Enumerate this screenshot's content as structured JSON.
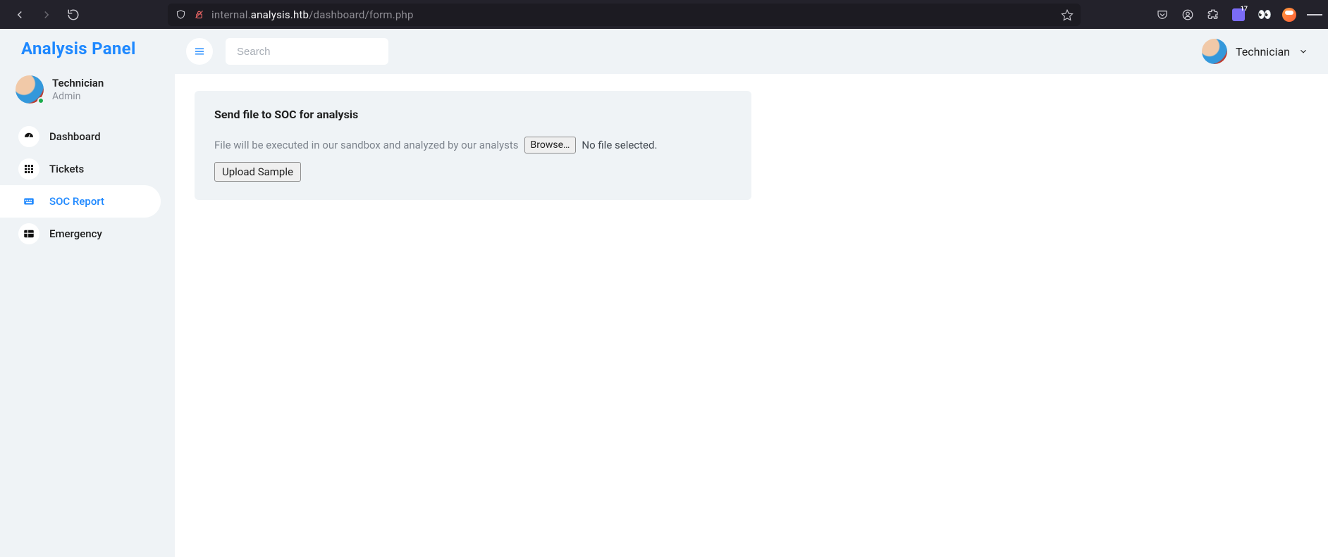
{
  "browser": {
    "url_prefix": "internal.",
    "url_host": "analysis.htb",
    "url_path": "/dashboard/form.php",
    "extension_badge": "17"
  },
  "brand": "Analysis Panel",
  "sidebar_user": {
    "name": "Technician",
    "role": "Admin"
  },
  "nav": {
    "items": [
      {
        "label": "Dashboard"
      },
      {
        "label": "Tickets"
      },
      {
        "label": "SOC Report"
      },
      {
        "label": "Emergency"
      }
    ],
    "active_index": 2
  },
  "topbar": {
    "search_placeholder": "Search",
    "user_name": "Technician"
  },
  "card": {
    "title": "Send file to SOC for analysis",
    "description": "File will be executed in our sandbox and analyzed by our analysts",
    "browse_label": "Browse…",
    "file_status": "No file selected.",
    "upload_label": "Upload Sample"
  }
}
